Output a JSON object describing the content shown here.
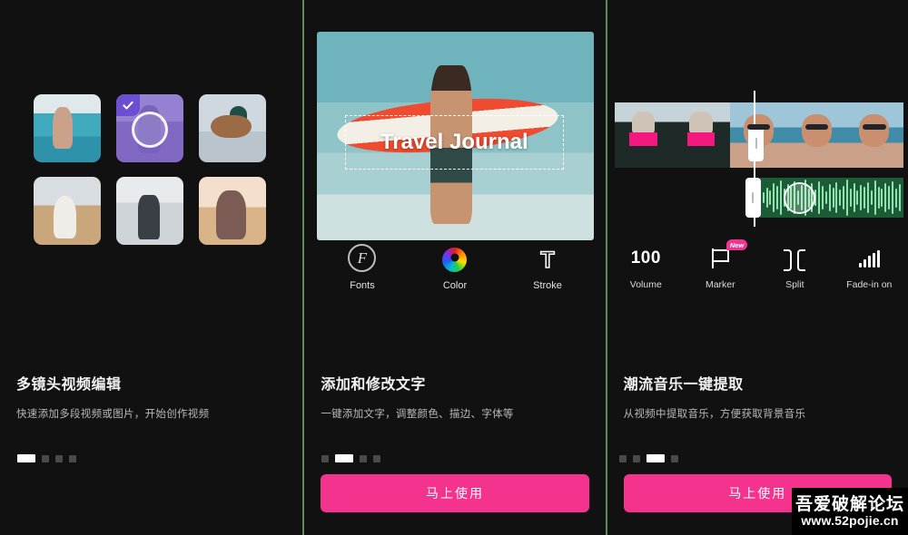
{
  "colors": {
    "background": "#111111",
    "divider": "#5d8a5f",
    "cta": "#f4338f",
    "badge_new": "#f4338f",
    "selection_purple": "#6b4fd0",
    "waveform": "#8fe3ae",
    "audio_track": "#1d5a36"
  },
  "panels": [
    {
      "id": "media-picker",
      "title": "多镜头视频编辑",
      "subtitle": "快速添加多段视频或图片，开始创作视频",
      "dots": {
        "count": 4,
        "active_index": 0
      },
      "cta_label": null,
      "thumbnails": [
        {
          "name": "beach-dance",
          "selected": false
        },
        {
          "name": "couple-purple",
          "selected": true
        },
        {
          "name": "guitar-walk",
          "selected": false
        },
        {
          "name": "field-dress",
          "selected": false
        },
        {
          "name": "snow-backpack",
          "selected": false
        },
        {
          "name": "sunset-woman",
          "selected": false
        }
      ],
      "selected_badge_icon": "check-icon",
      "loading_ring_icon": "loading-ring-icon"
    },
    {
      "id": "text-editor",
      "title": "添加和修改文字",
      "subtitle": "一键添加文字，调整颜色、描边、字体等",
      "dots": {
        "count": 4,
        "active_index": 1
      },
      "cta_label": "马上使用",
      "preview": {
        "overlay_text": "Travel Journal",
        "scene": "surfer-beach"
      },
      "tools": [
        {
          "label": "Fonts",
          "icon": "fonts-icon",
          "glyph": "F"
        },
        {
          "label": "Color",
          "icon": "color-wheel-icon"
        },
        {
          "label": "Stroke",
          "icon": "stroke-icon",
          "glyph": "T"
        }
      ]
    },
    {
      "id": "audio-extract",
      "title": "潮流音乐一键提取",
      "subtitle": "从视频中提取音乐，方便获取背景音乐",
      "dots": {
        "count": 4,
        "active_index": 2
      },
      "cta_label": "马上使用",
      "timeline": {
        "playhead_icon": "playhead-icon",
        "video_clip_handle_icon": "trim-handle-icon",
        "audio_clip_handle_icon": "trim-handle-icon",
        "audio_cursor_icon": "audio-cursor-icon",
        "waveform_levels": [
          28,
          54,
          40,
          78,
          62,
          90,
          46,
          72,
          58,
          84,
          38,
          66,
          94,
          50,
          76,
          42,
          88,
          60,
          34,
          70,
          52,
          80,
          44,
          64,
          96,
          48,
          74,
          36,
          68,
          56,
          82,
          40,
          90,
          58,
          46,
          78,
          62,
          86,
          50,
          72
        ]
      },
      "tools": [
        {
          "label": "Volume",
          "icon": "volume-icon",
          "value": "100"
        },
        {
          "label": "Marker",
          "icon": "flag-icon",
          "badge": "New"
        },
        {
          "label": "Split",
          "icon": "split-icon"
        },
        {
          "label": "Fade-in on",
          "icon": "fade-in-icon"
        }
      ]
    }
  ],
  "watermark": {
    "line1": "吾爱破解论坛",
    "line2": "www.52pojie.cn"
  }
}
